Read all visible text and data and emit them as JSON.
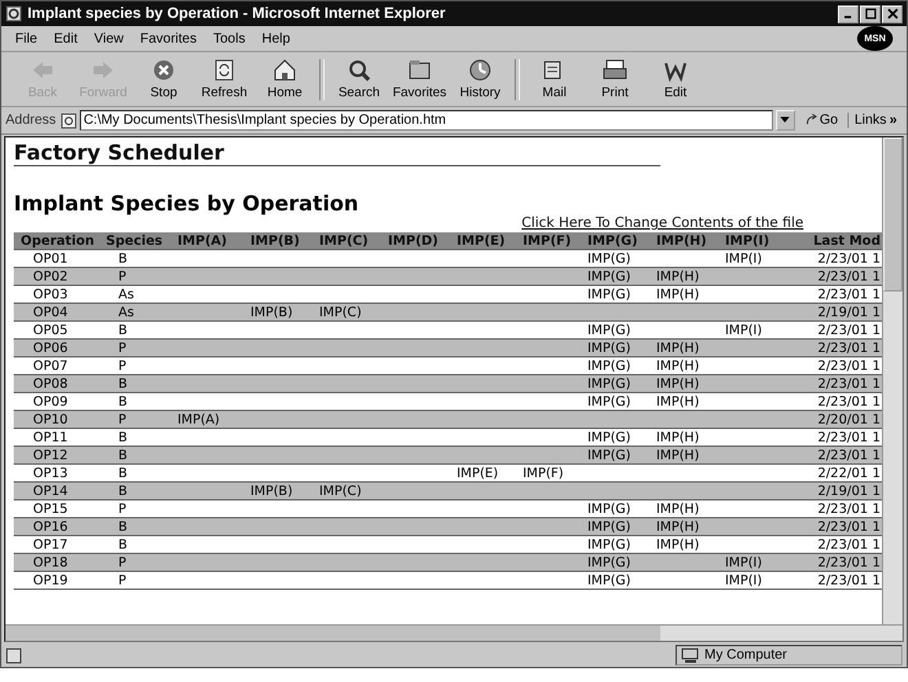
{
  "window": {
    "title": "Implant species by Operation - Microsoft Internet Explorer"
  },
  "menu": [
    "File",
    "Edit",
    "View",
    "Favorites",
    "Tools",
    "Help"
  ],
  "logo": "MSN",
  "toolbar": [
    {
      "label": "Back",
      "disabled": true
    },
    {
      "label": "Forward",
      "disabled": true
    },
    {
      "label": "Stop",
      "disabled": false
    },
    {
      "label": "Refresh",
      "disabled": false
    },
    {
      "label": "Home",
      "disabled": false
    },
    {
      "label": "Search",
      "disabled": false
    },
    {
      "label": "Favorites",
      "disabled": false
    },
    {
      "label": "History",
      "disabled": false
    },
    {
      "label": "Mail",
      "disabled": false
    },
    {
      "label": "Print",
      "disabled": false
    },
    {
      "label": "Edit",
      "disabled": false
    }
  ],
  "address": {
    "label": "Address",
    "value": "C:\\My Documents\\Thesis\\Implant species by Operation.htm",
    "go": "Go",
    "links": "Links",
    "chevron": "»"
  },
  "page": {
    "heading": "Factory Scheduler",
    "subheading": "Implant Species by Operation",
    "link": "Click Here To Change Contents of the file"
  },
  "table": {
    "columns": [
      "Operation",
      "Species",
      "IMP(A)",
      "IMP(B)",
      "IMP(C)",
      "IMP(D)",
      "IMP(E)",
      "IMP(F)",
      "IMP(G)",
      "IMP(H)",
      "IMP(I)",
      "Last Mod"
    ],
    "rows": [
      [
        "OP01",
        "B",
        "",
        "",
        "",
        "",
        "",
        "",
        "IMP(G)",
        "",
        "IMP(I)",
        "2/23/01 1"
      ],
      [
        "OP02",
        "P",
        "",
        "",
        "",
        "",
        "",
        "",
        "IMP(G)",
        "IMP(H)",
        "",
        "2/23/01 1"
      ],
      [
        "OP03",
        "As",
        "",
        "",
        "",
        "",
        "",
        "",
        "IMP(G)",
        "IMP(H)",
        "",
        "2/23/01 1"
      ],
      [
        "OP04",
        "As",
        "",
        "IMP(B)",
        "IMP(C)",
        "",
        "",
        "",
        "",
        "",
        "",
        "2/19/01 1"
      ],
      [
        "OP05",
        "B",
        "",
        "",
        "",
        "",
        "",
        "",
        "IMP(G)",
        "",
        "IMP(I)",
        "2/23/01 1"
      ],
      [
        "OP06",
        "P",
        "",
        "",
        "",
        "",
        "",
        "",
        "IMP(G)",
        "IMP(H)",
        "",
        "2/23/01 1"
      ],
      [
        "OP07",
        "P",
        "",
        "",
        "",
        "",
        "",
        "",
        "IMP(G)",
        "IMP(H)",
        "",
        "2/23/01 1"
      ],
      [
        "OP08",
        "B",
        "",
        "",
        "",
        "",
        "",
        "",
        "IMP(G)",
        "IMP(H)",
        "",
        "2/23/01 1"
      ],
      [
        "OP09",
        "B",
        "",
        "",
        "",
        "",
        "",
        "",
        "IMP(G)",
        "IMP(H)",
        "",
        "2/23/01 1"
      ],
      [
        "OP10",
        "P",
        "IMP(A)",
        "",
        "",
        "",
        "",
        "",
        "",
        "",
        "",
        "2/20/01 1"
      ],
      [
        "OP11",
        "B",
        "",
        "",
        "",
        "",
        "",
        "",
        "IMP(G)",
        "IMP(H)",
        "",
        "2/23/01 1"
      ],
      [
        "OP12",
        "B",
        "",
        "",
        "",
        "",
        "",
        "",
        "IMP(G)",
        "IMP(H)",
        "",
        "2/23/01 1"
      ],
      [
        "OP13",
        "B",
        "",
        "",
        "",
        "",
        "IMP(E)",
        "IMP(F)",
        "",
        "",
        "",
        "2/22/01 1"
      ],
      [
        "OP14",
        "B",
        "",
        "IMP(B)",
        "IMP(C)",
        "",
        "",
        "",
        "",
        "",
        "",
        "2/19/01 1"
      ],
      [
        "OP15",
        "P",
        "",
        "",
        "",
        "",
        "",
        "",
        "IMP(G)",
        "IMP(H)",
        "",
        "2/23/01 1"
      ],
      [
        "OP16",
        "B",
        "",
        "",
        "",
        "",
        "",
        "",
        "IMP(G)",
        "IMP(H)",
        "",
        "2/23/01 1"
      ],
      [
        "OP17",
        "B",
        "",
        "",
        "",
        "",
        "",
        "",
        "IMP(G)",
        "IMP(H)",
        "",
        "2/23/01 1"
      ],
      [
        "OP18",
        "P",
        "",
        "",
        "",
        "",
        "",
        "",
        "IMP(G)",
        "",
        "IMP(I)",
        "2/23/01 1"
      ],
      [
        "OP19",
        "P",
        "",
        "",
        "",
        "",
        "",
        "",
        "IMP(G)",
        "",
        "IMP(I)",
        "2/23/01 1"
      ]
    ]
  },
  "status_bar": {
    "zone": "My Computer"
  }
}
